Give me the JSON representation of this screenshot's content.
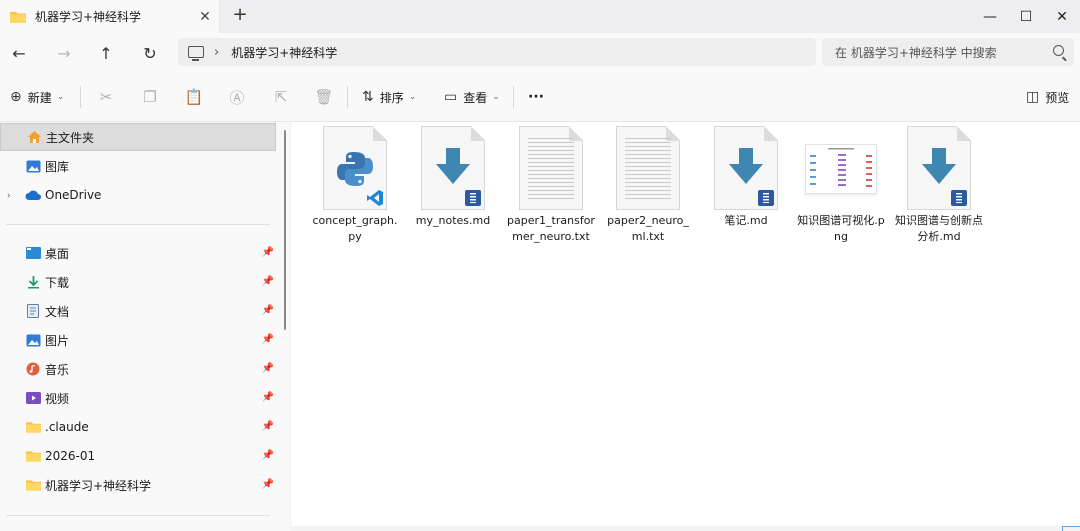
{
  "window": {
    "tab_title": "机器学习+神经科学",
    "tab_close": "✕",
    "new_tab": "+",
    "minimize": "—",
    "maximize": "☐",
    "close": "✕"
  },
  "navigation": {
    "back": "←",
    "forward": "→",
    "up": "↑",
    "refresh": "↻",
    "path_separator": "›",
    "path": "机器学习+神经科学",
    "search_placeholder": "在 机器学习+神经科学 中搜索"
  },
  "toolbar": {
    "new_label": "新建",
    "sort_label": "排序",
    "view_label": "查看",
    "more_label": "···",
    "preview_label": "预览"
  },
  "sidebar": {
    "home": "主文件夹",
    "gallery": "图库",
    "onedrive": "OneDrive",
    "quick_access": [
      {
        "label": "桌面"
      },
      {
        "label": "下载"
      },
      {
        "label": "文档"
      },
      {
        "label": "图片"
      },
      {
        "label": "音乐"
      },
      {
        "label": "视频"
      },
      {
        "label": ".claude"
      },
      {
        "label": "2026-01"
      },
      {
        "label": "机器学习+神经科学"
      }
    ]
  },
  "files": [
    {
      "name": "concept_graph.py",
      "icon": "python-file-icon"
    },
    {
      "name": "my_notes.md",
      "icon": "markdown-file-icon"
    },
    {
      "name": "paper1_transformer_neuro.txt",
      "icon": "text-file-icon"
    },
    {
      "name": "paper2_neuro_ml.txt",
      "icon": "text-file-icon"
    },
    {
      "name": "笔记.md",
      "icon": "markdown-file-icon"
    },
    {
      "name": "知识图谱可视化.png",
      "icon": "image-file-icon"
    },
    {
      "name": "知识图谱与创新点分析.md",
      "icon": "markdown-file-icon"
    }
  ],
  "colors": {
    "folder": "#f5c342",
    "arrow": "#3f87b1",
    "badge": "#2b5aa0",
    "selection": "#dcdcdc"
  }
}
